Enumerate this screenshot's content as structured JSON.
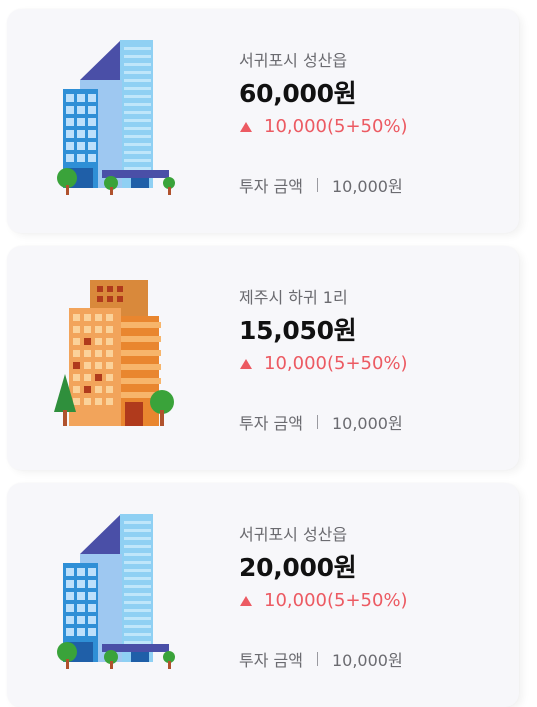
{
  "listings": [
    {
      "location": "서귀포시 성산읍",
      "price": "60,000원",
      "change": "10,000(5+50%)",
      "invest_label": "투자 금액",
      "invest_amount": "10,000원",
      "building_icon": "blue-office-tower-icon",
      "change_color": "#ec5a62"
    },
    {
      "location": "제주시 하귀 1리",
      "price": "15,050원",
      "change": "10,000(5+50%)",
      "invest_label": "투자 금액",
      "invest_amount": "10,000원",
      "building_icon": "orange-apartment-building-icon",
      "change_color": "#ec5a62"
    },
    {
      "location": "서귀포시 성산읍",
      "price": "20,000원",
      "change": "10,000(5+50%)",
      "invest_label": "투자 금액",
      "invest_amount": "10,000원",
      "building_icon": "blue-office-tower-icon",
      "change_color": "#ec5a62"
    }
  ]
}
